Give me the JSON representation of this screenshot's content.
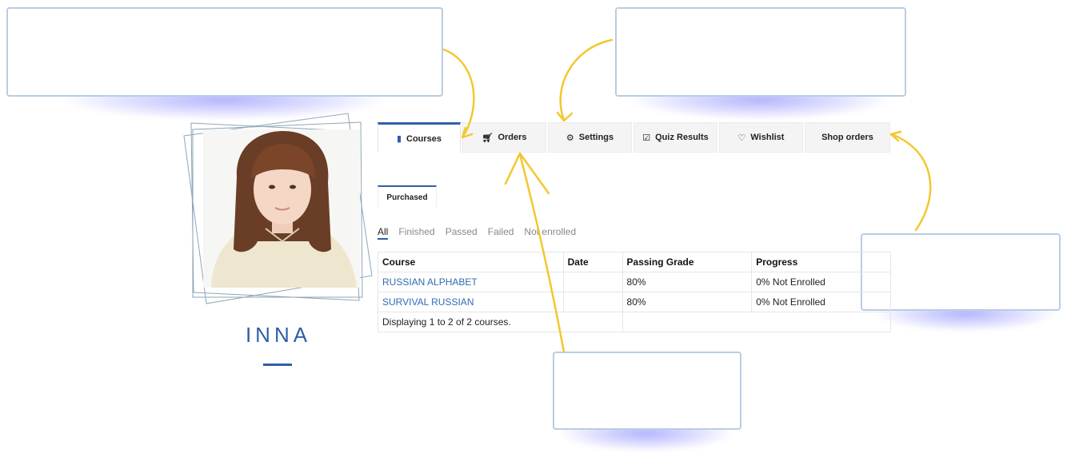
{
  "profile": {
    "name": "INNA"
  },
  "tabs": [
    {
      "label": "Courses",
      "icon": "book-icon",
      "active": true
    },
    {
      "label": "Orders",
      "icon": "cart-icon"
    },
    {
      "label": "Settings",
      "icon": "gear-icon"
    },
    {
      "label": "Quiz Results",
      "icon": "checkbox-icon"
    },
    {
      "label": "Wishlist",
      "icon": "heart-icon"
    },
    {
      "label": "Shop orders",
      "icon": ""
    }
  ],
  "subtab": {
    "label": "Purchased"
  },
  "filters": [
    "All",
    "Finished",
    "Passed",
    "Failed",
    "Not enrolled"
  ],
  "table": {
    "headers": [
      "Course",
      "Date",
      "Passing Grade",
      "Progress"
    ],
    "rows": [
      {
        "course": "RUSSIAN ALPHABET",
        "date": "",
        "grade": "80%",
        "progress": "0% Not Enrolled"
      },
      {
        "course": "SURVIVAL RUSSIAN",
        "date": "",
        "grade": "80%",
        "progress": "0% Not Enrolled"
      }
    ],
    "footer": "Displaying 1 to 2 of 2 courses."
  },
  "colors": {
    "accent": "#2f5ea8",
    "link": "#2f6bb0",
    "arrow": "#f2c82f",
    "callout_border": "#b7cde3"
  }
}
